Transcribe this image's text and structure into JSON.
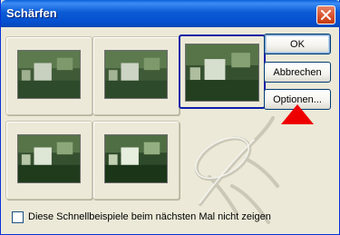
{
  "window": {
    "title": "Schärfen"
  },
  "titlebar": {
    "close_icon": "close-x-icon",
    "close_color": "#d9532e"
  },
  "thumbnails": [
    {
      "label": "preview-1",
      "selected": false
    },
    {
      "label": "preview-2",
      "selected": false
    },
    {
      "label": "preview-3",
      "selected": true
    },
    {
      "label": "preview-4",
      "selected": false
    },
    {
      "label": "preview-5",
      "selected": false
    }
  ],
  "buttons": {
    "ok": "OK",
    "cancel": "Abbrechen",
    "options": "Optionen..."
  },
  "footer": {
    "checkbox_checked": false,
    "checkbox_label": "Diese Schnellbeispiele beim nächsten Mal nicht zeigen"
  },
  "colors": {
    "dialog_bg": "#ece9d8",
    "selection_border": "#0b1fa8",
    "arrow": "#ee0000"
  }
}
